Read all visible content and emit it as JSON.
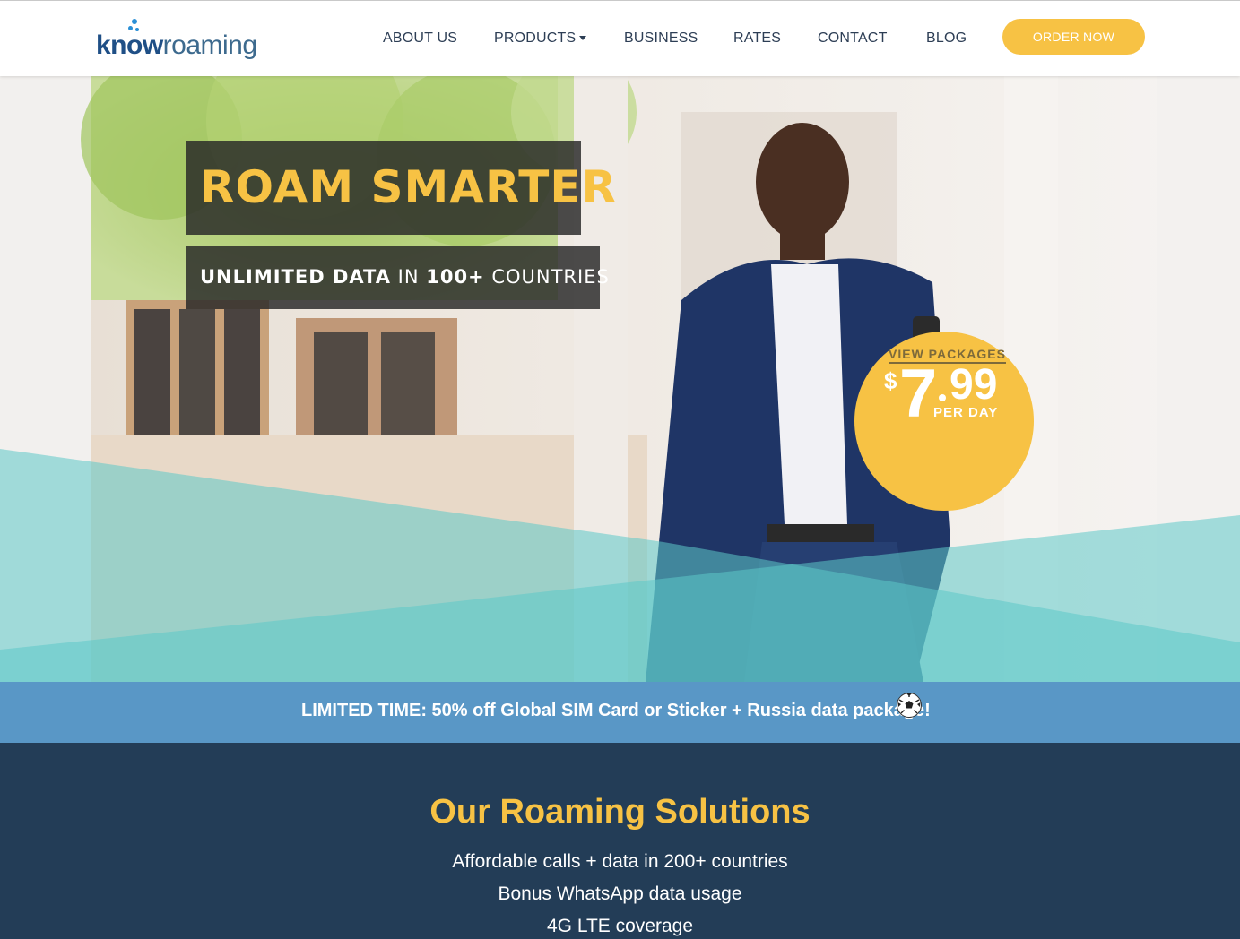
{
  "header": {
    "logo": {
      "part1": "know",
      "part2": "roaming"
    },
    "nav": [
      {
        "label": "ABOUT US"
      },
      {
        "label": "PRODUCTS",
        "has_dropdown": true
      },
      {
        "label": "BUSINESS"
      },
      {
        "label": "RATES"
      },
      {
        "label": "CONTACT"
      },
      {
        "label": "BLOG"
      }
    ],
    "cta_label": "ORDER NOW"
  },
  "hero": {
    "title": "ROAM SMARTER",
    "subtitle": {
      "part1": "UNLIMITED DATA",
      "part2": " IN ",
      "part3": "100+",
      "part4": " COUNTRIES"
    },
    "price": {
      "currency": "$",
      "amount_whole": "7",
      "amount_cents": "99",
      "unit": "PER DAY",
      "link_label": "VIEW PACKAGES"
    }
  },
  "promo": {
    "text": "LIMITED TIME: 50% off Global SIM Card or Sticker + Russia data package!",
    "icon": "soccer-ball-icon"
  },
  "solutions": {
    "title": "Our Roaming Solutions",
    "items": [
      "Affordable calls + data in 200+ countries",
      "Bonus WhatsApp data usage",
      "4G LTE coverage"
    ]
  },
  "colors": {
    "accent_yellow": "#f7c244",
    "nav_text": "#2d3e55",
    "promo_blue": "#5997c6",
    "navy": "#233d57",
    "teal": "#5cc8c8"
  }
}
